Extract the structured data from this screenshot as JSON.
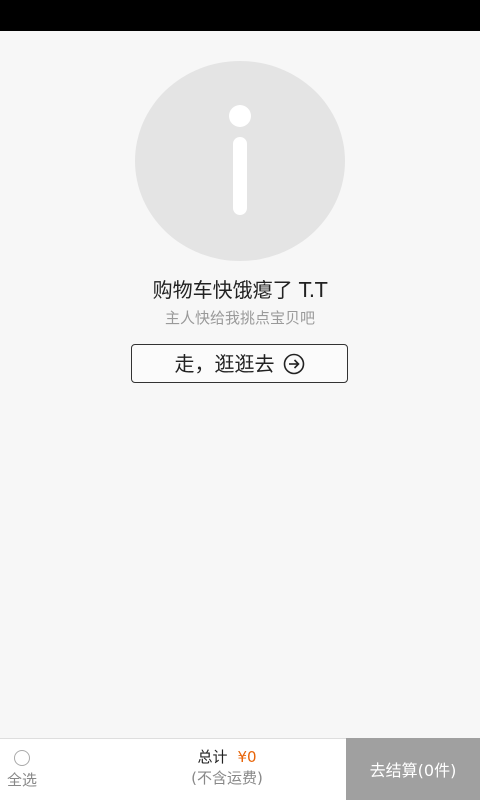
{
  "empty_state": {
    "icon": "info-icon",
    "title": "购物车快饿瘪了 T.T",
    "subtitle": "主人快给我挑点宝贝吧",
    "button_label": "走，逛逛去",
    "button_icon": "arrow-right-circle-icon"
  },
  "bottom_bar": {
    "select_all_label": "全选",
    "total_label": "总计",
    "total_amount": "¥0",
    "total_note": "(不含运费)",
    "checkout_label": "去结算(0件)"
  },
  "colors": {
    "status_bar": "#000000",
    "background": "#f7f7f7",
    "icon_circle": "#e4e4e4",
    "price": "#e8650a",
    "checkout_disabled": "#a0a0a0"
  }
}
